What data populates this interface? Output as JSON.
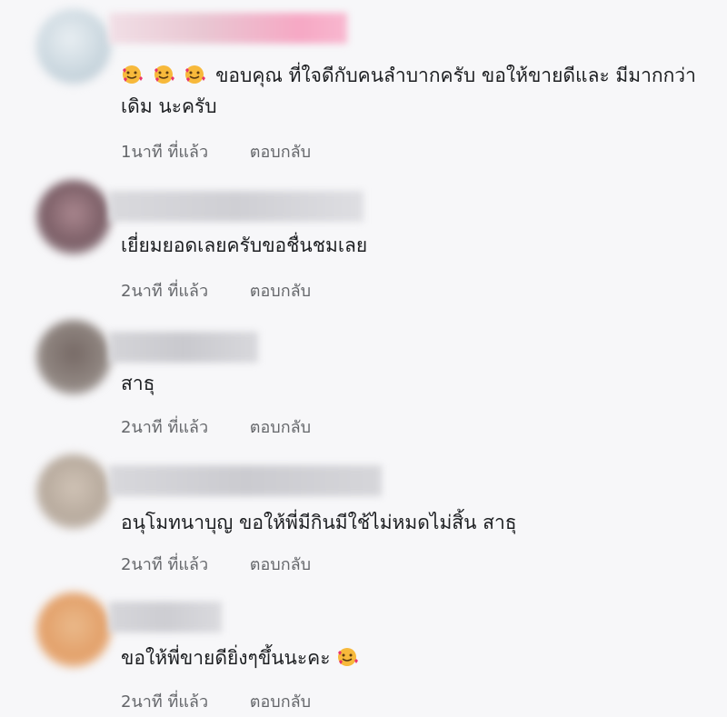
{
  "comments": [
    {
      "text": "ขอบคุณ ที่ใจดีกับคนลำบากครับ ขอให้ขายดีและ มีมากกว่าเดิม นะครับ",
      "time": "1นาที ที่แล้ว",
      "reply": "ตอบกลับ",
      "emoji_prefix": [
        "smiling-face-with-hearts-icon",
        "smiling-face-with-hearts-icon",
        "smiling-face-with-hearts-icon"
      ]
    },
    {
      "text": "เยี่ยมยอดเลยครับขอชื่นชมเลย",
      "time": "2นาที ที่แล้ว",
      "reply": "ตอบกลับ"
    },
    {
      "text": "สาธุ",
      "time": "2นาที ที่แล้ว",
      "reply": "ตอบกลับ"
    },
    {
      "text": "อนุโมทนาบุญ ขอให้พี่มีกินมีใช้ไม่หมดไม่สิ้น สาธุ",
      "time": "2นาที ที่แล้ว",
      "reply": "ตอบกลับ"
    },
    {
      "text": "ขอให้พี่ขายดียิ่งๆขึ้นนะคะ",
      "time": "2นาที ที่แล้ว",
      "reply": "ตอบกลับ",
      "emoji_suffix": [
        "smiling-face-with-hearts-icon"
      ]
    }
  ],
  "colors": {
    "background": "#f7f7f9",
    "text": "#1c1e21",
    "meta": "#65676b"
  }
}
